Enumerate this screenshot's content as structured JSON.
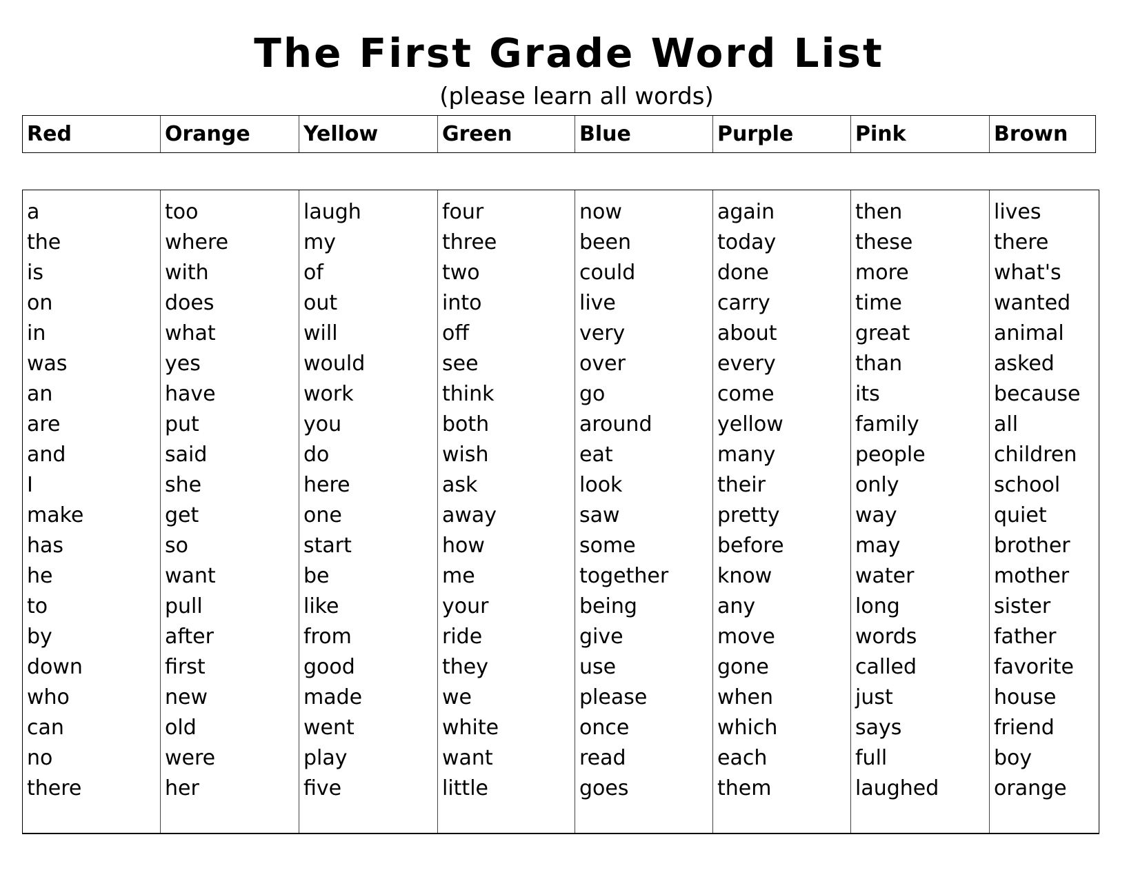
{
  "title": "The First Grade Word List",
  "subtitle": "(please learn all words)",
  "columns": [
    {
      "header": "Red",
      "words": [
        "a",
        "the",
        "is",
        "on",
        "in",
        "was",
        "an",
        "are",
        "and",
        "I",
        "make",
        "has",
        "he",
        "to",
        "by",
        "down",
        "who",
        "can",
        "no",
        "there"
      ]
    },
    {
      "header": "Orange",
      "words": [
        "too",
        "where",
        "with",
        "does",
        "what",
        "yes",
        "have",
        "put",
        "said",
        "she",
        "get",
        "so",
        "want",
        "pull",
        "after",
        "first",
        "new",
        "old",
        "were",
        "her"
      ]
    },
    {
      "header": "Yellow",
      "words": [
        "laugh",
        "my",
        "of",
        "out",
        "will",
        "would",
        "work",
        "you",
        "do",
        "here",
        "one",
        "start",
        "be",
        "like",
        "from",
        "good",
        "made",
        "went",
        "play",
        "five"
      ]
    },
    {
      "header": "Green",
      "words": [
        "four",
        "three",
        "two",
        "into",
        "off",
        "see",
        "think",
        "both",
        "wish",
        "ask",
        "away",
        "how",
        "me",
        "your",
        "ride",
        "they",
        "we",
        "white",
        "want",
        "little"
      ]
    },
    {
      "header": "Blue",
      "words": [
        "now",
        "been",
        "could",
        "live",
        "very",
        "over",
        "go",
        "around",
        "eat",
        "look",
        "saw",
        "some",
        "together",
        "being",
        "give",
        "use",
        "please",
        "once",
        "read",
        "goes"
      ]
    },
    {
      "header": "Purple",
      "words": [
        "again",
        "today",
        "done",
        "carry",
        "about",
        "every",
        "come",
        "yellow",
        "many",
        "their",
        "pretty",
        "before",
        "know",
        "any",
        "move",
        "gone",
        "when",
        "which",
        "each",
        "them"
      ]
    },
    {
      "header": "Pink",
      "words": [
        "then",
        "these",
        "more",
        "time",
        "great",
        "than",
        "its",
        "family",
        "people",
        "only",
        "way",
        "may",
        "water",
        "long",
        "words",
        "called",
        "just",
        "says",
        "full",
        "laughed"
      ]
    },
    {
      "header": "Brown",
      "words": [
        "lives",
        "there",
        "what's",
        "wanted",
        "animal",
        "asked",
        "because",
        "all",
        "children",
        "school",
        "quiet",
        "brother",
        "mother",
        "sister",
        "father",
        "favorite",
        "house",
        "friend",
        "boy",
        "orange"
      ]
    }
  ]
}
